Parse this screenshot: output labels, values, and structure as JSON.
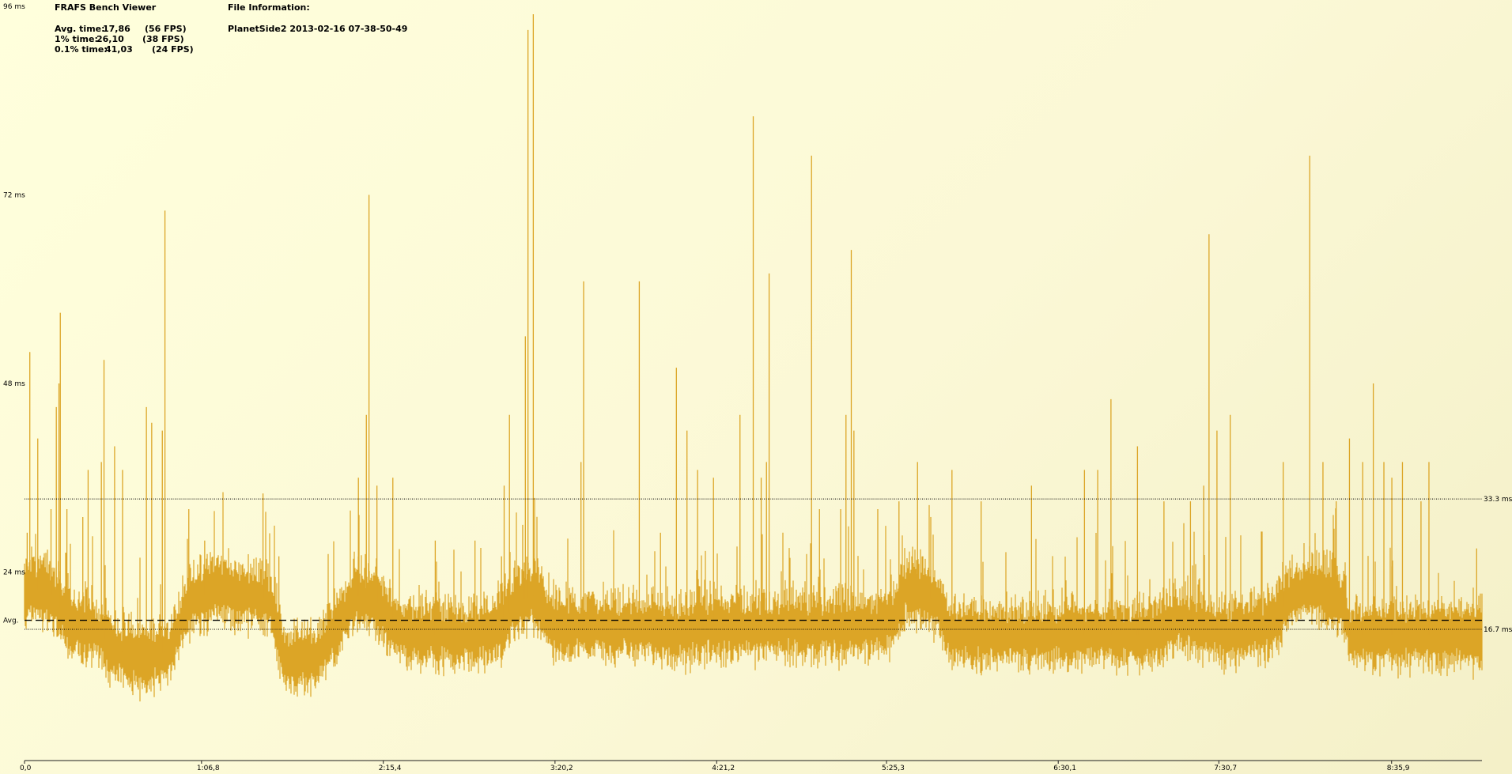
{
  "app": {
    "title": "FRAFS Bench Viewer"
  },
  "stats": {
    "avg": {
      "label": "Avg. time:",
      "value": "17,86",
      "fps": "(56 FPS)"
    },
    "p1": {
      "label": "1% time:",
      "value": "26,10",
      "fps": "(38 FPS)"
    },
    "p01": {
      "label": "0.1% time:",
      "value": "41,03",
      "fps": "(24 FPS)"
    }
  },
  "file_info": {
    "label": "File Information:",
    "name": "PlanetSide2 2013-02-16 07-38-50-49"
  },
  "colors": {
    "series": "#dca526",
    "background": "#ffffd8",
    "axis": "#1e1e1e"
  },
  "chart_data": {
    "type": "line",
    "title": "",
    "xlabel": "",
    "ylabel": "",
    "ylim": [
      0,
      96
    ],
    "xlim": [
      0,
      550
    ],
    "y_ticks": [
      {
        "value": 24,
        "label": "24 ms"
      },
      {
        "value": 48,
        "label": "48 ms"
      },
      {
        "value": 72,
        "label": "72 ms"
      },
      {
        "value": 96,
        "label": "96 ms"
      }
    ],
    "x_ticks": [
      {
        "value": 0,
        "label": "0,0"
      },
      {
        "value": 66.8,
        "label": "1:06,8"
      },
      {
        "value": 135.4,
        "label": "2:15,4"
      },
      {
        "value": 200.2,
        "label": "3:20,2"
      },
      {
        "value": 261.2,
        "label": "4:21,2"
      },
      {
        "value": 325.3,
        "label": "5:25,3"
      },
      {
        "value": 390.1,
        "label": "6:30,1"
      },
      {
        "value": 450.7,
        "label": "7:30,7"
      },
      {
        "value": 515.9,
        "label": "8:35,9"
      }
    ],
    "reference_lines": [
      {
        "value": 33.3,
        "label": "33.3 ms",
        "style": "dotted"
      },
      {
        "value": 16.7,
        "label": "16.7 ms",
        "style": "dotted"
      },
      {
        "value": 17.86,
        "label": "Avg.",
        "style": "dashed"
      }
    ],
    "series": [
      {
        "baseline": [
          [
            0,
            21
          ],
          [
            3,
            22
          ],
          [
            10,
            21
          ],
          [
            18,
            17
          ],
          [
            25,
            17
          ],
          [
            35,
            14
          ],
          [
            45,
            13
          ],
          [
            55,
            14
          ],
          [
            62,
            20
          ],
          [
            72,
            22
          ],
          [
            82,
            21
          ],
          [
            88,
            21
          ],
          [
            93,
            20
          ],
          [
            98,
            13
          ],
          [
            110,
            13
          ],
          [
            118,
            17
          ],
          [
            125,
            21
          ],
          [
            133,
            20
          ],
          [
            140,
            17
          ],
          [
            150,
            16
          ],
          [
            160,
            16
          ],
          [
            170,
            16
          ],
          [
            180,
            17
          ],
          [
            185,
            20
          ],
          [
            192,
            21
          ],
          [
            200,
            17
          ],
          [
            210,
            17
          ],
          [
            225,
            17
          ],
          [
            235,
            17
          ],
          [
            245,
            16
          ],
          [
            255,
            17
          ],
          [
            265,
            17
          ],
          [
            275,
            17
          ],
          [
            285,
            17
          ],
          [
            295,
            17
          ],
          [
            305,
            17
          ],
          [
            315,
            17
          ],
          [
            320,
            17
          ],
          [
            328,
            18
          ],
          [
            333,
            22
          ],
          [
            340,
            21
          ],
          [
            345,
            20
          ],
          [
            350,
            16
          ],
          [
            360,
            16
          ],
          [
            372,
            16
          ],
          [
            385,
            16
          ],
          [
            397,
            16
          ],
          [
            410,
            16
          ],
          [
            425,
            16
          ],
          [
            435,
            18
          ],
          [
            445,
            17
          ],
          [
            455,
            16
          ],
          [
            465,
            17
          ],
          [
            470,
            17
          ],
          [
            478,
            21
          ],
          [
            485,
            22
          ],
          [
            492,
            21
          ],
          [
            498,
            20
          ],
          [
            500,
            16
          ],
          [
            510,
            16
          ],
          [
            520,
            16
          ],
          [
            535,
            16
          ],
          [
            550,
            16
          ]
        ],
        "spikes": [
          [
            1,
            29
          ],
          [
            2,
            52
          ],
          [
            5,
            41
          ],
          [
            10,
            32
          ],
          [
            12,
            45
          ],
          [
            13,
            48
          ],
          [
            13.5,
            57
          ],
          [
            16,
            32
          ],
          [
            22,
            31
          ],
          [
            24,
            37
          ],
          [
            29,
            38
          ],
          [
            30,
            51
          ],
          [
            34,
            40
          ],
          [
            37,
            37
          ],
          [
            46,
            45
          ],
          [
            48,
            43
          ],
          [
            52,
            42
          ],
          [
            53,
            70
          ],
          [
            62,
            32
          ],
          [
            68,
            28
          ],
          [
            90,
            34
          ],
          [
            96,
            26
          ],
          [
            126,
            36
          ],
          [
            129,
            44
          ],
          [
            130,
            72
          ],
          [
            133,
            35
          ],
          [
            139,
            36
          ],
          [
            155,
            28
          ],
          [
            170,
            28
          ],
          [
            180,
            26
          ],
          [
            181,
            35
          ],
          [
            183,
            44
          ],
          [
            188,
            30
          ],
          [
            189,
            54
          ],
          [
            190,
            93
          ],
          [
            192,
            95
          ],
          [
            210,
            38
          ],
          [
            211,
            61
          ],
          [
            224,
            22
          ],
          [
            232,
            61
          ],
          [
            240,
            29
          ],
          [
            246,
            50
          ],
          [
            250,
            42
          ],
          [
            254,
            37
          ],
          [
            260,
            36
          ],
          [
            270,
            44
          ],
          [
            275,
            82
          ],
          [
            278,
            36
          ],
          [
            280,
            38
          ],
          [
            281,
            62
          ],
          [
            297,
            77
          ],
          [
            300,
            32
          ],
          [
            308,
            32
          ],
          [
            310,
            44
          ],
          [
            312,
            65
          ],
          [
            313,
            42
          ],
          [
            322,
            32
          ],
          [
            330,
            33
          ],
          [
            337,
            38
          ],
          [
            342,
            31
          ],
          [
            350,
            37
          ],
          [
            361,
            33
          ],
          [
            380,
            35
          ],
          [
            400,
            37
          ],
          [
            405,
            37
          ],
          [
            410,
            46
          ],
          [
            420,
            40
          ],
          [
            430,
            33
          ],
          [
            440,
            33
          ],
          [
            445,
            35
          ],
          [
            447,
            67
          ],
          [
            450,
            42
          ],
          [
            455,
            44
          ],
          [
            475,
            38
          ],
          [
            485,
            77
          ],
          [
            490,
            38
          ],
          [
            495,
            33
          ],
          [
            500,
            41
          ],
          [
            505,
            38
          ],
          [
            509,
            48
          ],
          [
            513,
            38
          ],
          [
            516,
            36
          ],
          [
            520,
            38
          ],
          [
            527,
            33
          ],
          [
            530,
            38
          ],
          [
            548,
            27
          ]
        ]
      }
    ]
  }
}
